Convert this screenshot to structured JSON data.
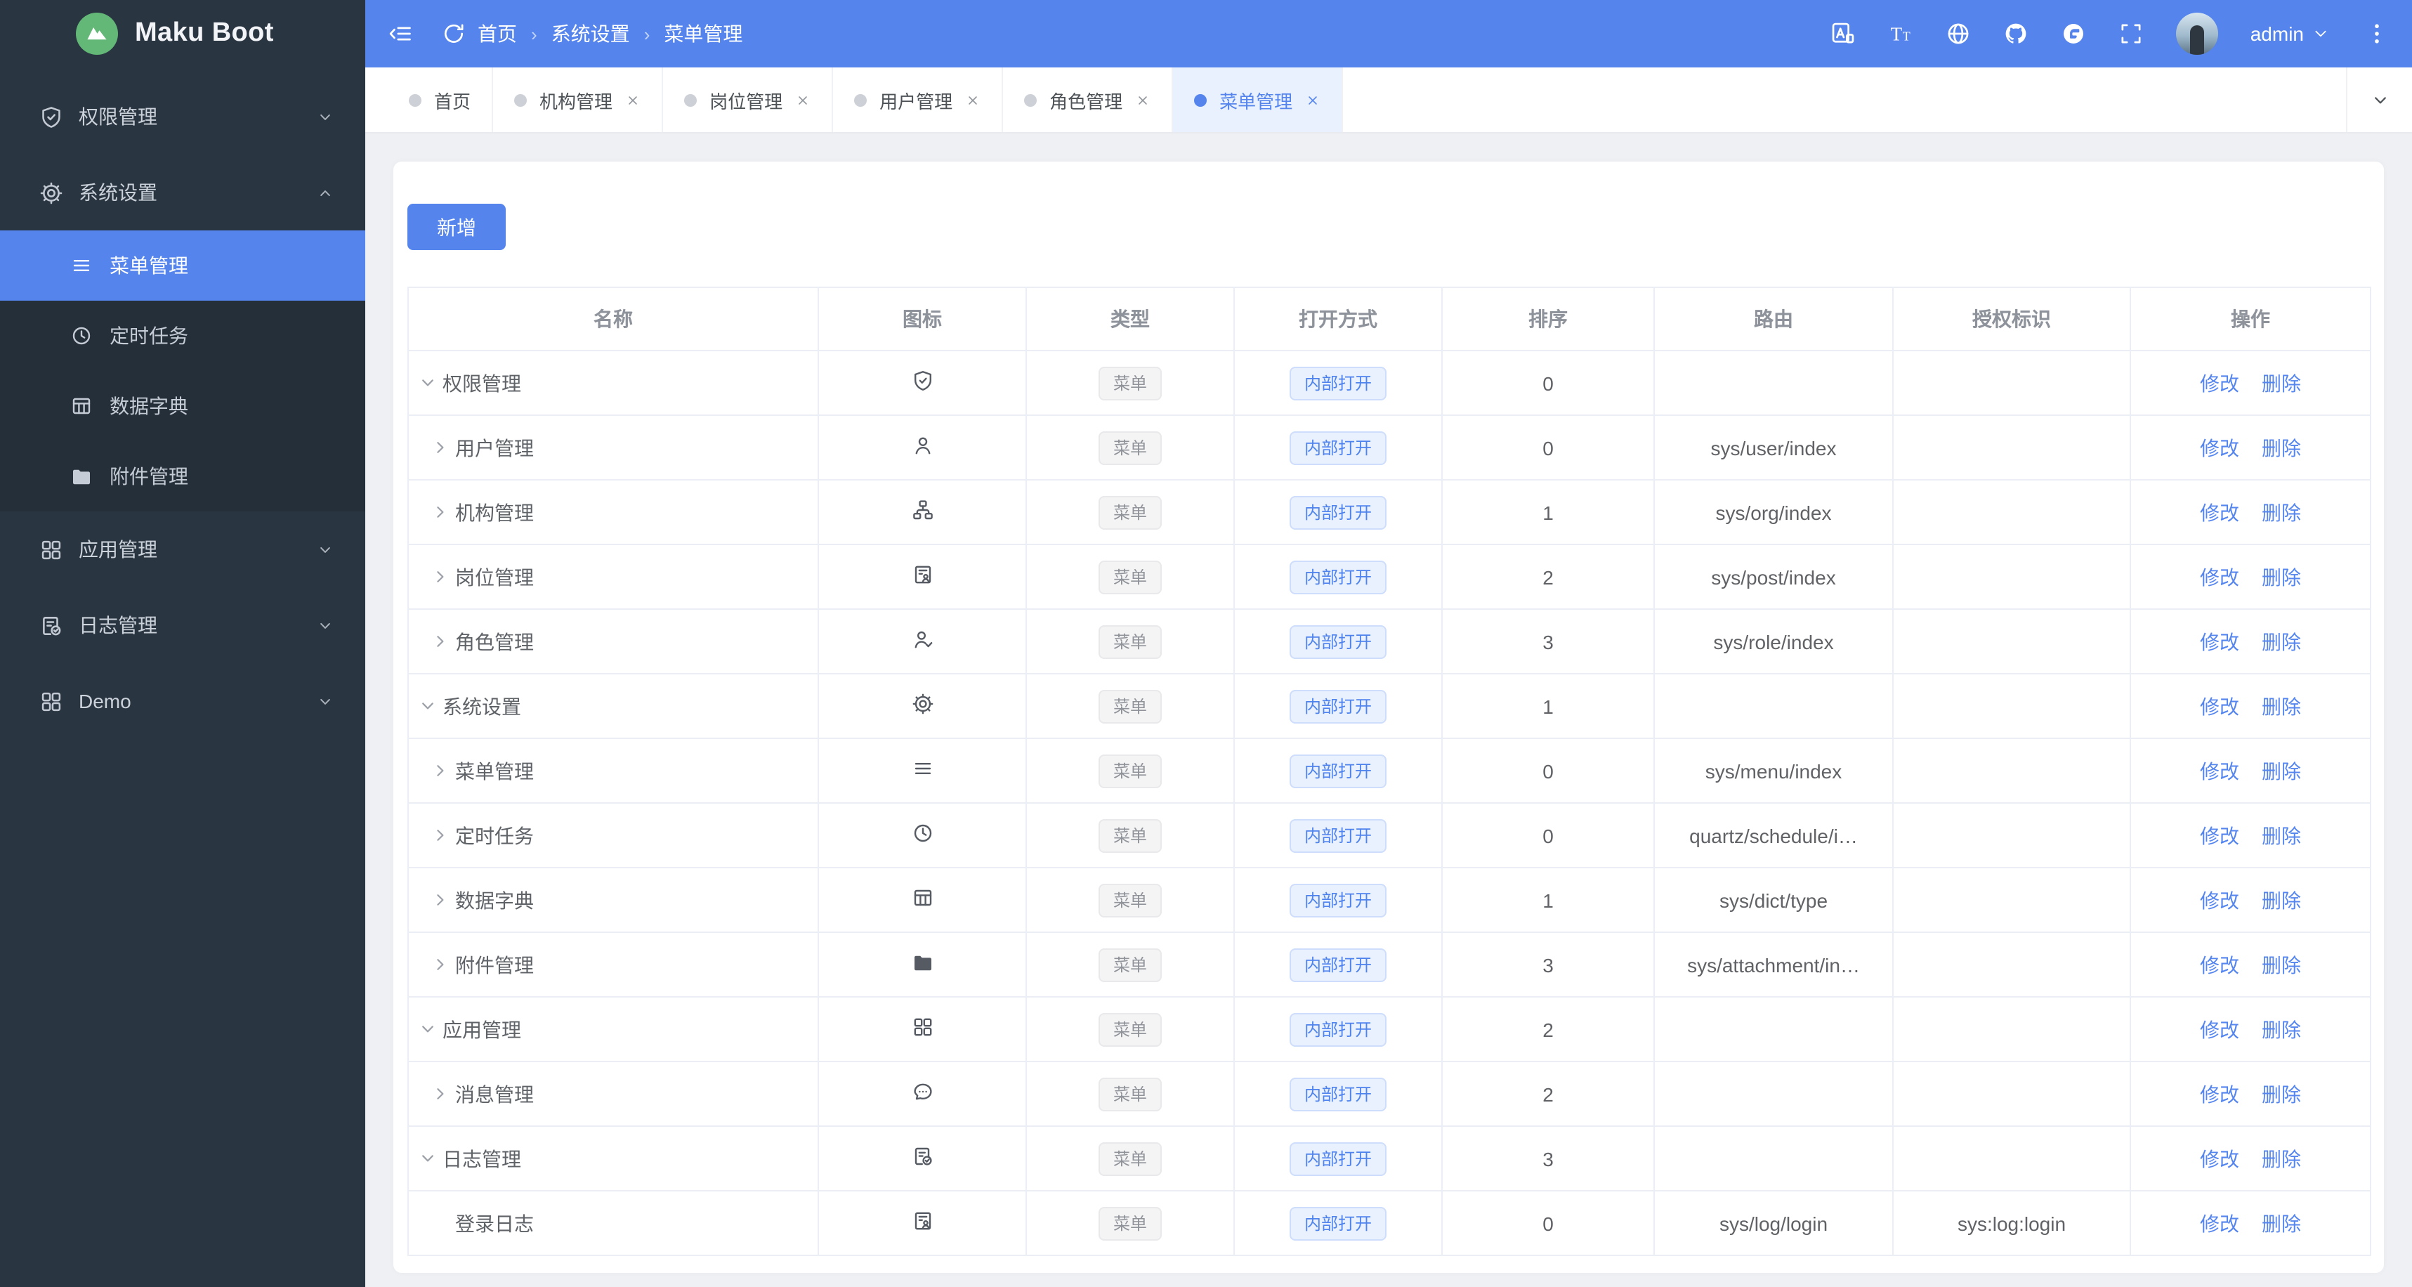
{
  "colors": {
    "primary": "#5585ec",
    "sidebar_bg": "#2a3542",
    "logo_green": "#63b877",
    "page_bg": "#eef0f4",
    "tag_gray_text": "#909399",
    "tag_blue_text": "#4e83ee",
    "link_blue": "#5585ee"
  },
  "logo": {
    "text": "Maku Boot",
    "icon": "mountain-logo"
  },
  "header": {
    "left_icons": [
      {
        "name": "fold",
        "label": "collapse-sidebar"
      },
      {
        "name": "refresh",
        "label": "refresh-page"
      }
    ],
    "breadcrumb": [
      "首页",
      "系统设置",
      "菜单管理"
    ],
    "right_icons": [
      {
        "name": "translate",
        "label": "language-translate"
      },
      {
        "name": "font-size",
        "label": "font-size"
      },
      {
        "name": "globe",
        "label": "locale"
      },
      {
        "name": "github",
        "label": "github"
      },
      {
        "name": "gitee",
        "label": "gitee"
      },
      {
        "name": "fullscreen",
        "label": "fullscreen"
      }
    ],
    "user": {
      "name": "admin",
      "caret_icon": "caret-down",
      "menu_icon": "kebab"
    }
  },
  "sidebar": [
    {
      "label": "权限管理",
      "icon": "shield-check",
      "chevron": "chevron-down",
      "expanded": false,
      "children": []
    },
    {
      "label": "系统设置",
      "icon": "gear",
      "chevron": "chevron-up",
      "expanded": true,
      "children": [
        {
          "label": "菜单管理",
          "icon": "menu-lines",
          "active": true
        },
        {
          "label": "定时任务",
          "icon": "clock",
          "active": false
        },
        {
          "label": "数据字典",
          "icon": "table-grid",
          "active": false
        },
        {
          "label": "附件管理",
          "icon": "folder-filled",
          "active": false
        }
      ]
    },
    {
      "label": "应用管理",
      "icon": "grid",
      "chevron": "chevron-down",
      "expanded": false,
      "children": []
    },
    {
      "label": "日志管理",
      "icon": "doc-check",
      "chevron": "chevron-down",
      "expanded": false,
      "children": []
    },
    {
      "label": "Demo",
      "icon": "grid",
      "chevron": "chevron-down",
      "expanded": false,
      "children": []
    }
  ],
  "tabs": [
    {
      "label": "首页",
      "closable": false,
      "active": false
    },
    {
      "label": "机构管理",
      "closable": true,
      "active": false
    },
    {
      "label": "岗位管理",
      "closable": true,
      "active": false
    },
    {
      "label": "用户管理",
      "closable": true,
      "active": false
    },
    {
      "label": "角色管理",
      "closable": true,
      "active": false
    },
    {
      "label": "菜单管理",
      "closable": true,
      "active": true
    }
  ],
  "tabbar": {
    "more_icon": "chevron-down"
  },
  "toolbar": {
    "add_label": "新增"
  },
  "table": {
    "columns": [
      "名称",
      "图标",
      "类型",
      "打开方式",
      "排序",
      "路由",
      "授权标识",
      "操作"
    ],
    "type_tag": "菜单",
    "open_tag": "内部打开",
    "actions": [
      "修改",
      "删除"
    ],
    "rows": [
      {
        "name": "权限管理",
        "icon": "shield-check",
        "expand": "down",
        "level": 0,
        "sort": "0",
        "route": "",
        "perm": ""
      },
      {
        "name": "用户管理",
        "icon": "user",
        "expand": "right",
        "level": 1,
        "sort": "0",
        "route": "sys/user/index",
        "perm": ""
      },
      {
        "name": "机构管理",
        "icon": "org",
        "expand": "right",
        "level": 1,
        "sort": "1",
        "route": "sys/org/index",
        "perm": ""
      },
      {
        "name": "岗位管理",
        "icon": "id-badge",
        "expand": "right",
        "level": 1,
        "sort": "2",
        "route": "sys/post/index",
        "perm": ""
      },
      {
        "name": "角色管理",
        "icon": "user-check",
        "expand": "right",
        "level": 1,
        "sort": "3",
        "route": "sys/role/index",
        "perm": ""
      },
      {
        "name": "系统设置",
        "icon": "gear",
        "expand": "down",
        "level": 0,
        "sort": "1",
        "route": "",
        "perm": ""
      },
      {
        "name": "菜单管理",
        "icon": "menu-lines",
        "expand": "right",
        "level": 1,
        "sort": "0",
        "route": "sys/menu/index",
        "perm": ""
      },
      {
        "name": "定时任务",
        "icon": "clock",
        "expand": "right",
        "level": 1,
        "sort": "0",
        "route": "quartz/schedule/i…",
        "perm": ""
      },
      {
        "name": "数据字典",
        "icon": "table-grid",
        "expand": "right",
        "level": 1,
        "sort": "1",
        "route": "sys/dict/type",
        "perm": ""
      },
      {
        "name": "附件管理",
        "icon": "folder-filled",
        "expand": "right",
        "level": 1,
        "sort": "3",
        "route": "sys/attachment/in…",
        "perm": ""
      },
      {
        "name": "应用管理",
        "icon": "grid",
        "expand": "down",
        "level": 0,
        "sort": "2",
        "route": "",
        "perm": ""
      },
      {
        "name": "消息管理",
        "icon": "chat",
        "expand": "right",
        "level": 1,
        "sort": "2",
        "route": "",
        "perm": ""
      },
      {
        "name": "日志管理",
        "icon": "doc-check",
        "expand": "down",
        "level": 0,
        "sort": "3",
        "route": "",
        "perm": ""
      },
      {
        "name": "登录日志",
        "icon": "id-badge",
        "expand": null,
        "level": 1,
        "sort": "0",
        "route": "sys/log/login",
        "perm": "sys:log:login"
      }
    ]
  }
}
